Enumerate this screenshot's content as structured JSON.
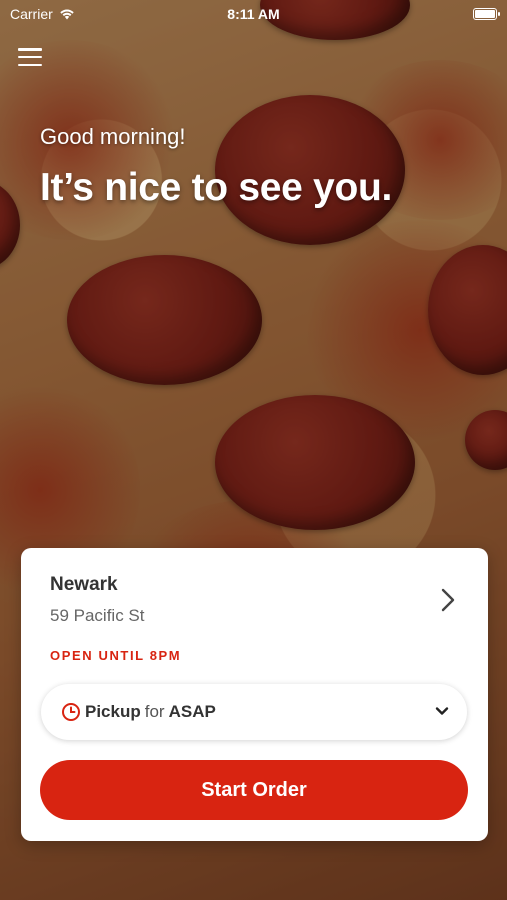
{
  "status_bar": {
    "carrier": "Carrier",
    "time": "8:11 AM",
    "icons": [
      "wifi-icon",
      "battery-icon"
    ]
  },
  "header": {
    "menu_icon": "hamburger-menu-icon"
  },
  "greeting": {
    "subtitle": "Good morning!",
    "title": "It’s nice to see you."
  },
  "store_card": {
    "store_name": "Newark",
    "store_address": "59 Pacific St",
    "hours_label": "OPEN UNTIL 8PM",
    "pickup": {
      "mode": "Pickup",
      "connector": "for",
      "time": "ASAP"
    },
    "start_order_label": "Start Order"
  },
  "colors": {
    "accent": "#d82411",
    "card_bg": "#ffffff",
    "text_dark": "#333333",
    "text_muted": "#666666"
  }
}
